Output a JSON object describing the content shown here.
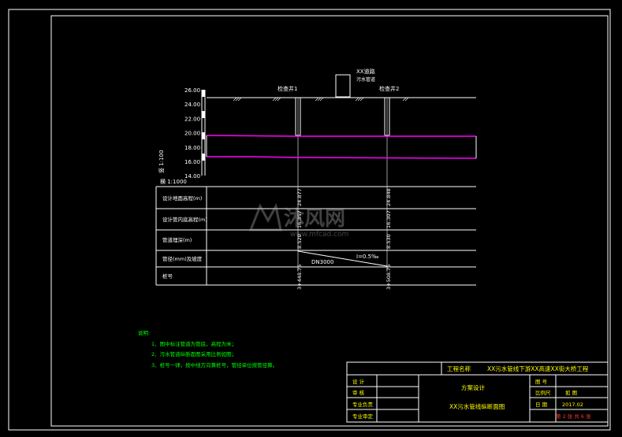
{
  "drawing": {
    "colors": {
      "background": "#000000",
      "frame": "#ffffff",
      "ground_line": "#ffffff",
      "pipe": "#ff00ff",
      "notes": "#00ff00",
      "title_text": "#ffff00",
      "title_red": "#ff3333"
    },
    "scales": {
      "horizontal": "横 1:1000",
      "vertical": "竖 1:100"
    },
    "elevation_ticks": [
      "26.00",
      "24.00",
      "22.00",
      "20.00",
      "18.00",
      "16.00",
      "14.00"
    ],
    "annotations": {
      "manhole_1": "检查井1",
      "manhole_2": "检查井2",
      "building_line1": "XX道路",
      "building_line2": "污水管道"
    },
    "table_rows": [
      "设计地面高程(m)",
      "设计管内底高程(m)",
      "管道埋深(m)",
      "管径(mm)及坡度",
      "桩号"
    ],
    "table_values": {
      "ground_1": "24.877",
      "ground_2": "24.848",
      "invert_1": "16.357",
      "invert_2": "16.307",
      "depth_1": "8.520",
      "depth_2": "8.530",
      "pipe_size": "DN3000",
      "slope": "I=0.5‰",
      "chainage_1": "3+448.75",
      "chainage_2": "3+508.75"
    },
    "watermark": {
      "brand": "沐风网",
      "url": "www.mfcad.com"
    }
  },
  "notes": {
    "heading": "说明:",
    "items": [
      "1、图中标注管道为管底，高程为米；",
      "2、污水管道纵断面图采用比例如图；",
      "3、桩号一律，按中线方向算桩号，管径单位按管径算。"
    ]
  },
  "title_block": {
    "project_label": "工程名称",
    "project_name": "XX污水管线下游XX高速XX街大桥工程",
    "stage": "方案设计",
    "drawing_title": "XX污水管线纵断面图",
    "left_labels": [
      "设 计",
      "审 核",
      "专业负责",
      "专业审定"
    ],
    "drawing_no_label": "图 号",
    "scale_label": "比例尺",
    "scale_value": "如 图",
    "date_label": "日 期",
    "date_value": "2017.02",
    "sheet_info": "第 2 张  共 6 张"
  }
}
